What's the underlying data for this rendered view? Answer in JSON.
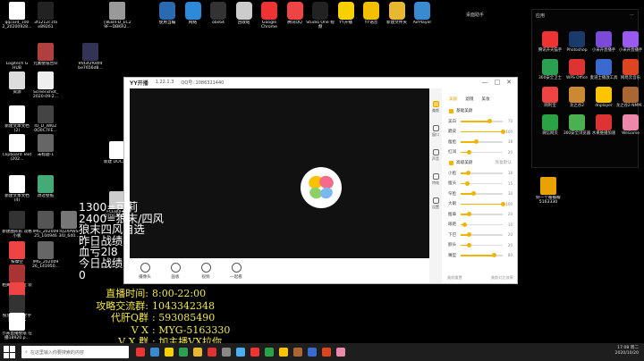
{
  "desktop": {
    "icons": [
      {
        "label": "qqcard_100 2_20200928...",
        "color": "#fff"
      },
      {
        "label": "3f1212c1fa e89261",
        "color": "#222"
      },
      {
        "label": "{8EB4-D_EC2 9F~DBKR2...",
        "color": "#999"
      },
      {
        "label": "Logitech G HUB",
        "color": "#000"
      },
      {
        "label": "元素壁纸合众",
        "color": "#b04040"
      },
      {
        "label": "9fd3f2f04fd be7656d8...",
        "color": "#335"
      },
      {
        "label": "资源",
        "color": "#ddd"
      },
      {
        "label": "Screenshot_ 2020-09-2...",
        "color": "#eee"
      },
      {
        "label": "新建文本文档 (2)",
        "color": "#fff"
      },
      {
        "label": "IO_D_WKIZ 0O0C7FE...",
        "color": "#444"
      },
      {
        "label": "Clipboard Text (202...",
        "color": "#fff"
      },
      {
        "label": "未标题-1",
        "color": "#666"
      },
      {
        "label": "新建 DOCX 档",
        "color": "#fff"
      },
      {
        "label": "新建文本文档 (4)",
        "color": "#fff"
      },
      {
        "label": "改过壁纸",
        "color": "#4a7"
      },
      {
        "label": "FCEB0FC6 D7DEA6B1...",
        "color": "#ccc"
      },
      {
        "label": "新建图形形 双格小板",
        "color": "#333"
      },
      {
        "label": "IMG_202009 25_104946",
        "color": "#555"
      },
      {
        "label": "IQ2XPWS 3IU_640...",
        "color": "#777"
      },
      {
        "label": "按摩空",
        "color": "#e44"
      },
      {
        "label": "IMG_202009 26_141950...",
        "color": "#666"
      },
      {
        "label": "相关女壹教室 装拍的BK",
        "color": "#a33"
      },
      {
        "label": "按摩空",
        "color": "#e44"
      },
      {
        "label": "投放了播放文字 黄中的BK",
        "color": "#333"
      },
      {
        "label": "小米直播壁纸 在播18920.p...",
        "color": "#fff"
      },
      {
        "label": "好一个瓣瓣瓣 5163330",
        "color": "#e8a300"
      }
    ],
    "topbar": [
      {
        "label": "使用当编",
        "color": "#2a6ab0"
      },
      {
        "label": "网络",
        "color": "#2d8ad8"
      },
      {
        "label": "obs64",
        "color": "#333"
      },
      {
        "label": "回收站",
        "color": "#ccc"
      },
      {
        "label": "Google Chrome",
        "color": "#e33"
      },
      {
        "label": "腾讯QQ",
        "color": "#e44"
      },
      {
        "label": "Studio One 视频",
        "color": "#222"
      },
      {
        "label": "YY开播",
        "color": "#f7d000"
      },
      {
        "label": "YY语音",
        "color": "#f3c000"
      },
      {
        "label": "新建文件夹",
        "color": "#e8b830"
      },
      {
        "label": "AirPlayer",
        "color": "#3a8ad0"
      }
    ]
  },
  "right_panel": {
    "header_left": "桌面助手",
    "header_right": "应用",
    "apps": [
      {
        "label": "腾讯开天猫手",
        "color": "#e33"
      },
      {
        "label": "Photoshop",
        "color": "#1a3a6a"
      },
      {
        "label": "小米开直播手",
        "color": "#7a4ad8"
      },
      {
        "label": "小米开直播手",
        "color": "#9a5af0"
      },
      {
        "label": "360安全卫士",
        "color": "#2aa050"
      },
      {
        "label": "WPS Office",
        "color": "#d33"
      },
      {
        "label": "麦道士播放工具",
        "color": "#3a6ad0"
      },
      {
        "label": "网易云音乐",
        "color": "#d42"
      },
      {
        "label": "网利宝",
        "color": "#e44"
      },
      {
        "label": "龙之谷2",
        "color": "#c83"
      },
      {
        "label": "dnplayer",
        "color": "#ffc400"
      },
      {
        "label": "龙之谷2-NMM...",
        "color": "#a63"
      },
      {
        "label": "微信网页",
        "color": "#2ba245"
      },
      {
        "label": "360安全浏览器",
        "color": "#4ab050"
      },
      {
        "label": "水果维播加速",
        "color": "#d33"
      },
      {
        "label": "WeGame",
        "color": "#e8a"
      }
    ]
  },
  "app_window": {
    "title": "YY开播",
    "version": "1.22.1.3",
    "qq_info": "QQ号: 1086321440",
    "controls": [
      "—",
      "□",
      "✕"
    ],
    "sidebar": [
      {
        "label": "美颜",
        "active": true
      },
      {
        "label": "窗口",
        "active": false
      },
      {
        "label": "声音",
        "active": false
      },
      {
        "label": "特效",
        "active": false
      },
      {
        "label": "设置",
        "active": false
      }
    ],
    "beauty_tabs": [
      "美颜",
      "滤镜",
      "美妆"
    ],
    "section1": "基础美颜",
    "sliders1": [
      {
        "name": "美白",
        "value": 70
      },
      {
        "name": "磨皮",
        "value": 100
      },
      {
        "name": "瘦脸",
        "value": 38
      },
      {
        "name": "红润",
        "value": 20
      }
    ],
    "section2": "高级美颜",
    "section2_right": "恢复默认",
    "sliders2": [
      {
        "name": "小脸",
        "value": 18
      },
      {
        "name": "瘦头",
        "value": 15
      },
      {
        "name": "窄脸",
        "value": 30
      },
      {
        "name": "大眼",
        "value": 100
      },
      {
        "name": "瘦鼻",
        "value": 20
      },
      {
        "name": "眼距",
        "value": 10
      },
      {
        "name": "下巴",
        "value": 20
      },
      {
        "name": "额头",
        "value": 20
      },
      {
        "name": "嘴型",
        "value": 80
      }
    ],
    "footer_left": "美颜重置",
    "footer_right": "美颜对比效果",
    "tools": [
      "摄像头",
      "画板",
      "视频",
      "一起看"
    ]
  },
  "overlay_white": [
    "1300=可莉",
    "2400=狼末/四风",
    "狼末四风自选",
    "昨日战绩",
    "血亏2l8",
    "今日战绩",
    "0"
  ],
  "overlay_yellow": [
    {
      "k": "直播时间:",
      "v": "8:00-22:00"
    },
    {
      "k": "攻略交流群:",
      "v": "1043342348"
    },
    {
      "k": "代肝Q群",
      "v": ": 593085490"
    },
    {
      "k": "V X",
      "v": ": MYG-5163330"
    },
    {
      "k": "V X 群",
      "v": ": 加主播VX拉你"
    }
  ],
  "taskbar": {
    "search_placeholder": "在这里输入你要搜索的内容",
    "time": "17:08 周二",
    "date": "2020/10/20",
    "icons": [
      "#e33",
      "#3a8ad0",
      "#f7d000",
      "#2aa050",
      "#e8b830",
      "#d33",
      "#888",
      "#4ab0f0",
      "#e33",
      "#2ba245",
      "#ffc400",
      "#a63",
      "#3a6ad0",
      "#d42",
      "#e8a"
    ]
  }
}
